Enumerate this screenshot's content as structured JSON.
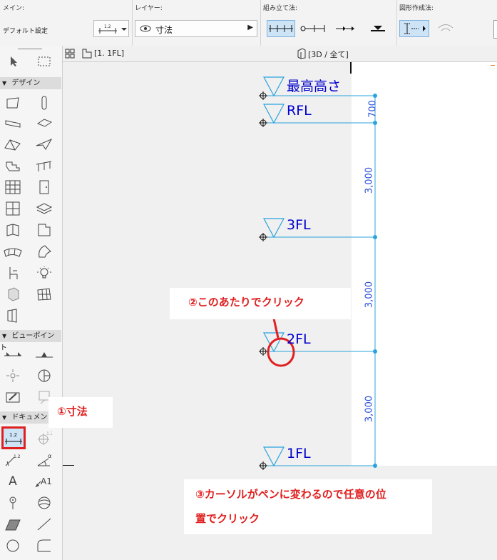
{
  "toolbar": {
    "main_label": "メイン:",
    "default_settings": "デフォルト設定",
    "dim_icon_value": "1.2",
    "layer_label": "レイヤー:",
    "layer_value": "寸法",
    "construction_label": "組み立て法:",
    "geometry_label": "図形作成法:"
  },
  "tabs": {
    "floor_plan": "[1. 1FL]",
    "view_3d": "[3D / 全て]"
  },
  "palette": {
    "design": "デザイン",
    "viewpoint": "ビューポイント",
    "document": "ドキュメント",
    "dim_value": "1.2",
    "text_tool": "A",
    "label_tool": "A1"
  },
  "stories": [
    {
      "name": "最高高さ"
    },
    {
      "name": "RFL"
    },
    {
      "name": "3FL"
    },
    {
      "name": "2FL"
    },
    {
      "name": "1FL"
    }
  ],
  "dimensions": [
    "700",
    "3,000",
    "3,000",
    "3,000"
  ],
  "callouts": {
    "step1": "①寸法",
    "step2": "②このあたりでクリック",
    "step3_line1": "③カーソルがペンに変わるので任意の位",
    "step3_line2": "置でクリック"
  },
  "colors": {
    "story_line": "#29a3dd",
    "story_text": "#0000cc",
    "dim_color": "#2a4fd8",
    "annotation": "#e02020"
  }
}
